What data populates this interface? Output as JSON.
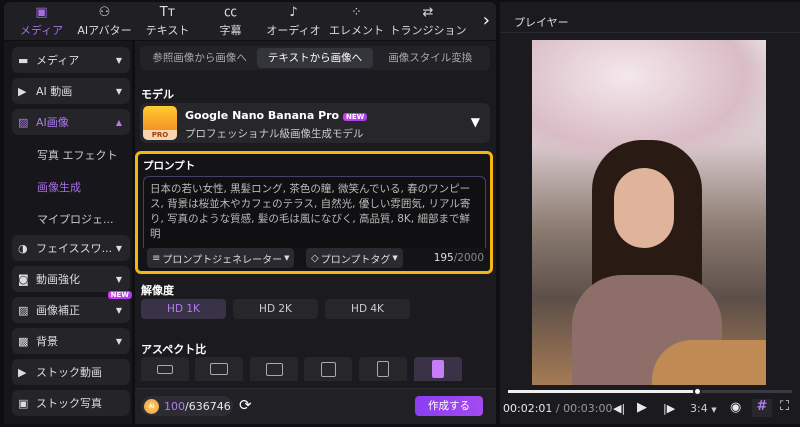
{
  "nav": {
    "tabs": [
      {
        "label": "メディア",
        "icon": "media-icon"
      },
      {
        "label": "AIアバター",
        "icon": "avatar-icon"
      },
      {
        "label": "テキスト",
        "icon": "text-icon"
      },
      {
        "label": "字幕",
        "icon": "caption-icon"
      },
      {
        "label": "オーディオ",
        "icon": "audio-icon"
      },
      {
        "label": "エレメント",
        "icon": "element-icon"
      },
      {
        "label": "トランジション",
        "icon": "transition-icon"
      }
    ],
    "active": "メディア"
  },
  "sidebar": {
    "items": [
      {
        "label": "メディア"
      },
      {
        "label": "AI 動画"
      },
      {
        "label": "AI画像"
      },
      {
        "label": "フェイススワ..."
      },
      {
        "label": "動画強化"
      },
      {
        "label": "画像補正",
        "badge": "NEW"
      },
      {
        "label": "背景"
      },
      {
        "label": "ストック動画"
      },
      {
        "label": "ストック写真"
      }
    ],
    "subitems": [
      {
        "label": "写真 エフェクト"
      },
      {
        "label": "画像生成"
      },
      {
        "label": "マイプロジェ..."
      }
    ]
  },
  "main": {
    "tabs": [
      "参照画像から画像へ",
      "テキストから画像へ",
      "画像スタイル変換"
    ],
    "model_label": "モデル",
    "model_name": "Google Nano Banana Pro",
    "model_badge": "NEW",
    "model_desc": "プロフェッショナル級画像生成モデル",
    "model_thumb_text": "PRO",
    "prompt_label": "プロンプト",
    "prompt_text": "日本の若い女性, 黒髪ロング, 茶色の瞳, 微笑んでいる, 春のワンピース, 背景は桜並木やカフェのテラス, 自然光, 優しい雰囲気, リアル寄り, 写真のような質感, 髪の毛は風になびく, 高品質, 8K, 細部まで鮮明",
    "prompt_generator": "プロンプトジェネレーター",
    "prompt_tag": "プロンプトタグ",
    "char_count": "195",
    "char_max": "/2000",
    "resolution_label": "解像度",
    "resolutions": [
      "HD 1K",
      "HD 2K",
      "HD 4K"
    ],
    "aspect_label": "アスペクト比",
    "credits_used": "100",
    "credits_total": "/636746",
    "create_button": "作成する"
  },
  "player": {
    "title": "プレイヤー",
    "current_time": "00:02:01",
    "total_time": "/ 00:03:00",
    "progress": 0.67,
    "ratio": "3:4"
  },
  "colors": {
    "accent": "#a86ee6",
    "highlight": "#f5b614"
  }
}
